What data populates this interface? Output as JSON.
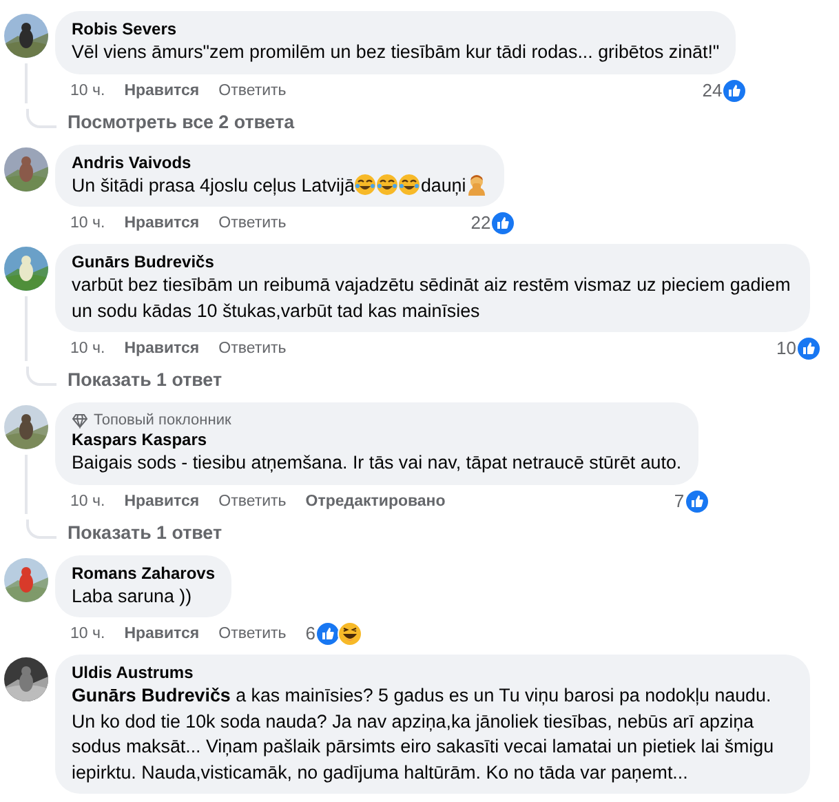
{
  "comments": [
    {
      "author": "Robis Severs",
      "body": [
        {
          "kind": "text",
          "text": "Vēl viens āmurs\"zem promilēm un bez tiesībām kur tādi rodas... gribētos zināt!\""
        }
      ],
      "time": "10 ч.",
      "like": "Нравится",
      "reply": "Ответить",
      "reaction_count": "24",
      "reactions": [
        {
          "kind": "like"
        }
      ],
      "replies_link": "Посмотреть все 2 ответа"
    },
    {
      "author": "Andris Vaivods",
      "body": [
        {
          "kind": "text",
          "text": "Un šitādi prasa 4joslu ceļus Latvijā"
        },
        {
          "kind": "laughing"
        },
        {
          "kind": "laughing"
        },
        {
          "kind": "laughing"
        },
        {
          "kind": "text",
          "text": "dauņi"
        },
        {
          "kind": "facepalm"
        }
      ],
      "time": "10 ч.",
      "like": "Нравится",
      "reply": "Ответить",
      "reaction_count": "22",
      "reactions": [
        {
          "kind": "like"
        }
      ]
    },
    {
      "author": "Gunārs Budrevičs",
      "body": [
        {
          "kind": "text",
          "text": "varbūt bez tiesībām un reibumā vajadzētu sēdināt aiz restēm vismaz uz pieciem gadiem un sodu kādas 10 štukas,varbūt tad kas mainīsies"
        }
      ],
      "time": "10 ч.",
      "like": "Нравится",
      "reply": "Ответить",
      "reaction_count": "10",
      "reactions": [
        {
          "kind": "like"
        }
      ],
      "replies_link": "Показать 1 ответ"
    },
    {
      "badge": "Топовый поклонник",
      "author": "Kaspars Kaspars",
      "body": [
        {
          "kind": "text",
          "text": "Baigais sods - tiesibu atņemšana. Ir tās vai nav, tāpat netraucē stūrēt auto."
        }
      ],
      "time": "10 ч.",
      "like": "Нравится",
      "reply": "Ответить",
      "edited": "Отредактировано",
      "reaction_count": "7",
      "reactions": [
        {
          "kind": "like"
        }
      ],
      "replies_link": "Показать 1 ответ"
    },
    {
      "author": "Romans Zaharovs",
      "body": [
        {
          "kind": "text",
          "text": "Laba saruna ))"
        }
      ],
      "time": "10 ч.",
      "like": "Нравится",
      "reply": "Ответить",
      "reaction_count": "6",
      "reactions": [
        {
          "kind": "like"
        },
        {
          "kind": "haha"
        }
      ]
    },
    {
      "author": "Uldis Austrums",
      "body": [
        {
          "kind": "text",
          "text": "**Gunārs Budrevičs** a kas mainīsies? 5 gadus es un Tu viņu barosi pa nodokļu naudu. Un ko dod tie 10k soda nauda? Ja nav apziņa,ka jānoliek tiesības, nebūs arī apziņa sodus maksāt... Viņam pašlaik pārsimts eiro sakasīti vecai lamatai un pietiek lai šmigu iepirktu. Nauda,visticamāk, no gadījuma haltūrām. Ko no tāda var paņemt..."
        }
      ]
    }
  ]
}
